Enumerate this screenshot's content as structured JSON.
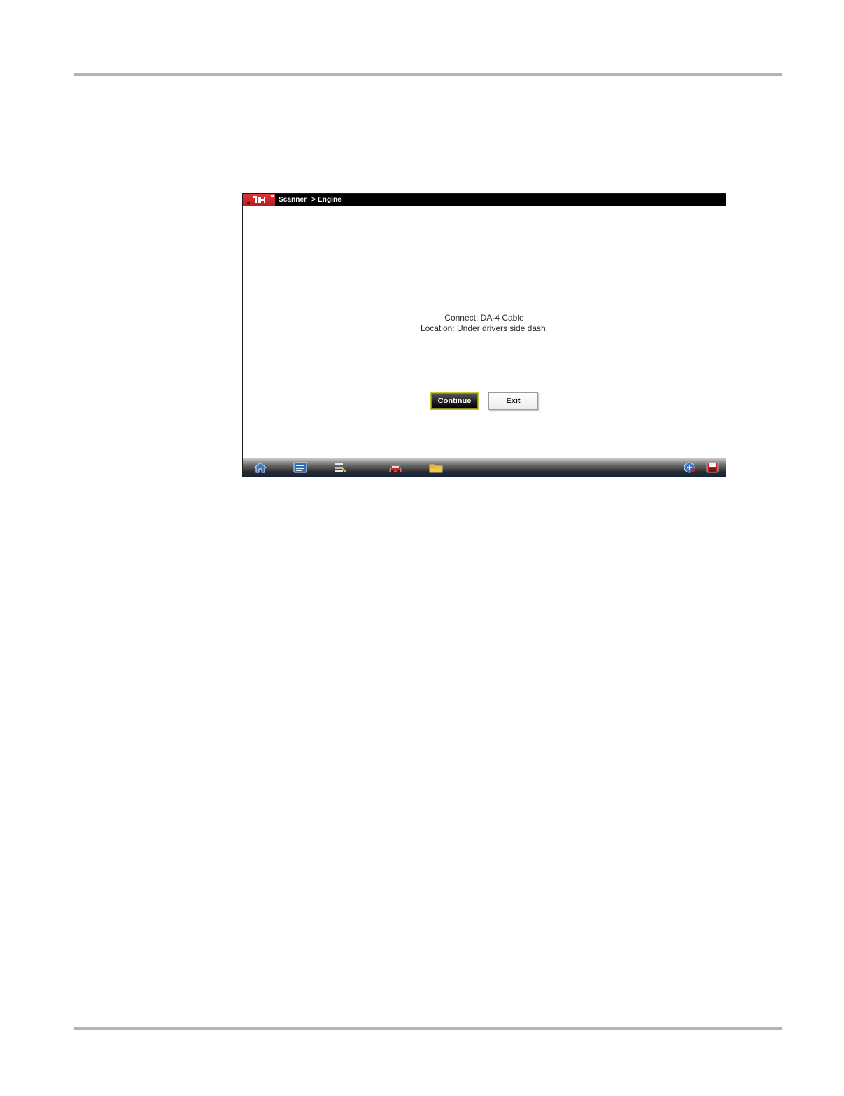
{
  "window": {
    "breadcrumb": [
      "Scanner",
      "> Engine"
    ]
  },
  "dialog": {
    "line1": "Connect: DA-4 Cable",
    "line2": "Location: Under drivers side dash.",
    "continue_label": "Continue",
    "exit_label": "Exit"
  },
  "taskbar": {
    "icons": [
      "home-icon",
      "scanner-icon",
      "tools-icon",
      "vehicle-icon",
      "folder-icon",
      "connection-icon",
      "save-icon"
    ]
  },
  "colors": {
    "brand_red": "#d32a2f",
    "title_bar": "#000000",
    "continue_focus_border": "#c8c830"
  }
}
